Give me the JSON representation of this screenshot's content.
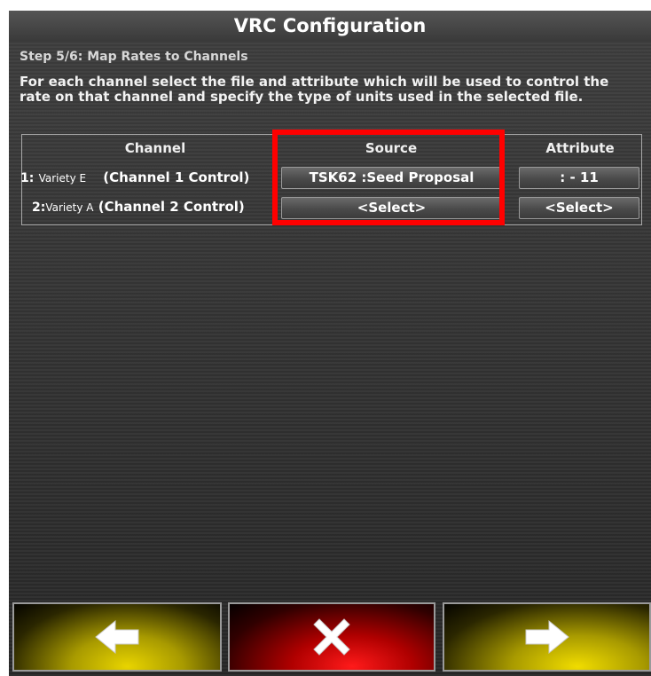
{
  "window": {
    "title": "VRC Configuration"
  },
  "wizard": {
    "step": "Step 5/6: Map Rates to Channels",
    "instructions": "For each channel select the file and attribute which will be used to control the rate on that channel and specify the type of units used in the selected file."
  },
  "table": {
    "headers": {
      "channel": "Channel",
      "source": "Source",
      "attribute": "Attribute"
    },
    "rows": [
      {
        "num": "1:",
        "variety": "Variety E",
        "control": "(Channel 1 Control)",
        "source": "TSK62 :Seed Proposal",
        "attribute": ": - 11"
      },
      {
        "num": "2:",
        "variety": "Variety A",
        "control": "(Channel 2 Control)",
        "source": "<Select>",
        "attribute": "<Select>"
      }
    ]
  },
  "highlight_color": "#ff0000",
  "nav": {
    "back_icon": "arrow-left-icon",
    "cancel_icon": "close-x-icon",
    "next_icon": "arrow-right-icon",
    "colors": {
      "back": "#d4c400",
      "cancel": "#e00000",
      "next": "#d4c400"
    }
  }
}
